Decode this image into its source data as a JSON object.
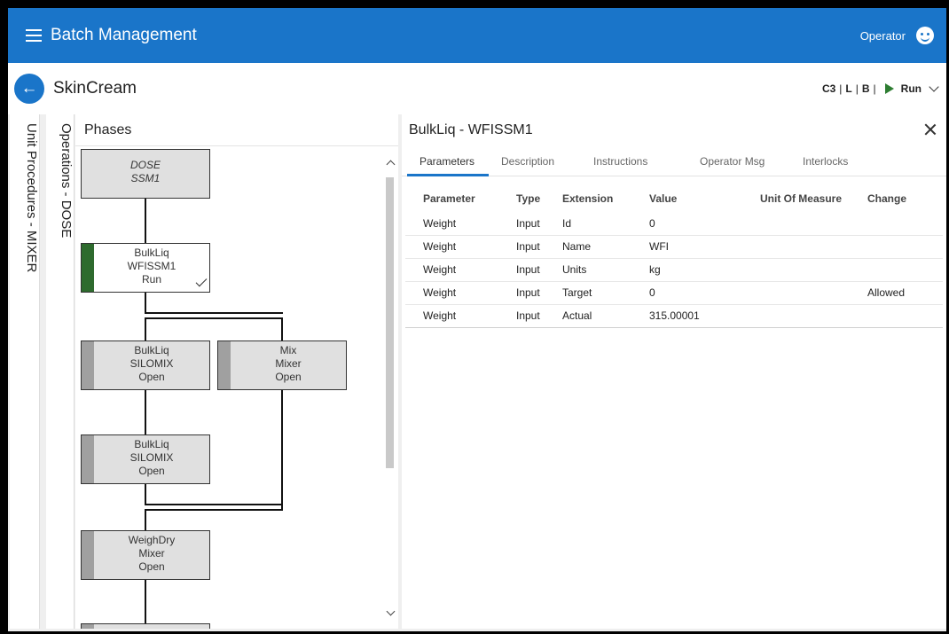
{
  "app": {
    "title": "Batch Management",
    "role": "Operator"
  },
  "subbar": {
    "recipe": "SkinCream",
    "status": {
      "c": "C3",
      "l": "L",
      "b": "B",
      "state": "Run"
    }
  },
  "side": {
    "unit_procedures": "Unit Procedures - MIXER",
    "operations": "Operations - DOSE"
  },
  "phases": {
    "title": "Phases",
    "blocks": [
      {
        "l1": "DOSE",
        "l2": "SSM1",
        "l3": ""
      },
      {
        "l1": "BulkLiq",
        "l2": "WFISSM1",
        "l3": "Run"
      },
      {
        "l1": "BulkLiq",
        "l2": "SILOMIX",
        "l3": "Open"
      },
      {
        "l1": "Mix",
        "l2": "Mixer",
        "l3": "Open"
      },
      {
        "l1": "BulkLiq",
        "l2": "SILOMIX",
        "l3": "Open"
      },
      {
        "l1": "WeighDry",
        "l2": "Mixer",
        "l3": "Open"
      }
    ]
  },
  "detail": {
    "title": "BulkLiq - WFISSM1",
    "tabs": [
      "Parameters",
      "Description",
      "Instructions",
      "Operator Msg",
      "Interlocks"
    ],
    "columns": [
      "Parameter",
      "Type",
      "Extension",
      "Value",
      "Unit Of Measure",
      "Change"
    ],
    "rows": [
      [
        "Weight",
        "Input",
        "Id",
        "0",
        "",
        ""
      ],
      [
        "Weight",
        "Input",
        "Name",
        "WFI",
        "",
        ""
      ],
      [
        "Weight",
        "Input",
        "Units",
        "kg",
        "",
        ""
      ],
      [
        "Weight",
        "Input",
        "Target",
        "0",
        "",
        "Allowed"
      ],
      [
        "Weight",
        "Input",
        "Actual",
        "315.00001",
        "",
        ""
      ]
    ]
  },
  "colors": {
    "accent": "#1a75c9",
    "run_green": "#2e6b2e"
  }
}
